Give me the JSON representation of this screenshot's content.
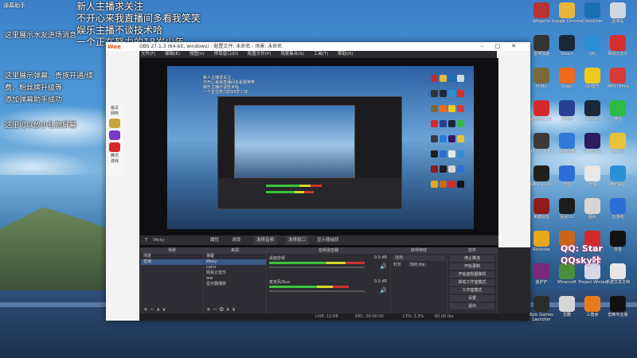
{
  "stream_overlay": {
    "corner_title": "弹幕助手",
    "lines_top": [
      "新人主播求关注",
      "不开心来我直播间多看我笑笑",
      "娱乐主播不谈技术哈",
      "一个正在努力的18岁少年"
    ],
    "left_messages": [
      "这里展示水友进场消息",
      "这里展示弹幕、贵族开通/续",
      "费、粉丝牌升级等",
      "添加弹幕助手成功",
      "这里可以放小礼物屏幕"
    ]
  },
  "obs": {
    "title": "OBS 27.1.3 (64-bit, windows) - 配置文件: 未命名 - 场景: 未命名",
    "logo": "Wee",
    "menu": [
      "文件(F)",
      "编辑(E)",
      "视图(V)",
      "停靠窗口(D)",
      "配置文件(P)",
      "场景集合(S)",
      "工具(T)",
      "帮助(H)"
    ],
    "tabbar": {
      "properties": "属性",
      "filters": "滤镜",
      "select_source": "选择音频",
      "select_monitor": "选择窗口",
      "source_name": "显示器捕获"
    },
    "panels": {
      "scenes": {
        "header": "场景",
        "items": [
          "场景",
          "直播"
        ]
      },
      "sources": {
        "header": "来源",
        "items": [
          "弹幕",
          "Weky",
          "cairo",
          "网易云音乐",
          "ww",
          "显示器捕获"
        ]
      },
      "mixer": {
        "header": "音频混音器",
        "tracks": [
          {
            "name": "桌面音频",
            "level": "0.0 dB"
          },
          {
            "name": "麦克风/Aux",
            "level": "0.0 dB"
          }
        ]
      },
      "transitions": {
        "header": "转场特效",
        "type": "淡出",
        "duration_label": "时长",
        "duration": "300 ms"
      },
      "controls": {
        "header": "控件",
        "buttons": [
          "停止推流",
          "开始录制",
          "开始虚拟摄像机",
          "启动工作室模式",
          "工作室模式",
          "设置",
          "退出"
        ]
      }
    },
    "status": {
      "live": "LIVE: 12:08",
      "rec": "REC: 00:00:00",
      "cpu": "CPU: 3.3%",
      "fps": "60.00 fps"
    }
  },
  "lol_sidebar": {
    "label1": "最近",
    "label2": "网吧",
    "label3": "腾讯",
    "label4": "游戏"
  },
  "desktop_icons": [
    {
      "label": "Wegame",
      "color": "#b83232"
    },
    {
      "label": "Google Chrome",
      "color": "#e8b63a"
    },
    {
      "label": "CrossOver",
      "color": "#1b6fb5"
    },
    {
      "label": "回收站",
      "color": "#cfd8e0"
    },
    {
      "label": "雷神加速",
      "color": "#333333"
    },
    {
      "label": "Steam",
      "color": "#1b2838"
    },
    {
      "label": "QQ",
      "color": "#2d8fd6"
    },
    {
      "label": "网易云音乐",
      "color": "#d62f2f"
    },
    {
      "label": "PUBG",
      "color": "#7a6a3a"
    },
    {
      "label": "Origin",
      "color": "#f26a1b"
    },
    {
      "label": "QQ音乐",
      "color": "#f2c81b"
    },
    {
      "label": "WPS Office",
      "color": "#d83a3a"
    },
    {
      "label": "Among Us",
      "color": "#d6282a"
    },
    {
      "label": "UPlay",
      "color": "#2a3f8f"
    },
    {
      "label": "Steam",
      "color": "#1b2838"
    },
    {
      "label": "微信",
      "color": "#2dbb45"
    },
    {
      "label": "PUBG LITE",
      "color": "#3a3a3a"
    },
    {
      "label": "百度网盘",
      "color": "#2f7ad8"
    },
    {
      "label": "Premiere",
      "color": "#2d1b5e"
    },
    {
      "label": "鲁大师",
      "color": "#e8c33a"
    },
    {
      "label": "OBS Studio",
      "color": "#202020"
    },
    {
      "label": "迅雷",
      "color": "#2d6ed6"
    },
    {
      "label": "微博",
      "color": "#e8e8e8"
    },
    {
      "label": "腾讯会议",
      "color": "#2d8fd6"
    },
    {
      "label": "英雄联盟",
      "color": "#8f1b1b"
    },
    {
      "label": "网易UU",
      "color": "#1d1d1d"
    },
    {
      "label": "图片",
      "color": "#d6d6d6"
    },
    {
      "label": "云游戏",
      "color": "#2d6ed6"
    },
    {
      "label": "Rockstar",
      "color": "#e8a81b"
    },
    {
      "label": "CS:GO",
      "color": "#c8671b"
    },
    {
      "label": "迅游",
      "color": "#d6282a"
    },
    {
      "label": "抖音",
      "color": "#111111"
    },
    {
      "label": "金铲铲",
      "color": "#7a2a7a"
    },
    {
      "label": "Minecraft",
      "color": "#4a8f3a"
    },
    {
      "label": "Project Winter",
      "color": "#d6d6e6"
    },
    {
      "label": "新建文本文档",
      "color": "#e6e6e6"
    },
    {
      "label": "Epic Games Launcher",
      "color": "#2b2b2b"
    },
    {
      "label": "优酷",
      "color": "#d6d6d6"
    },
    {
      "label": "三角洲",
      "color": "#e87a1b"
    },
    {
      "label": "剪映专业版",
      "color": "#111111"
    }
  ],
  "qq_overlay": {
    "line1": "QQ: Star",
    "line2": "QQsky咔"
  }
}
